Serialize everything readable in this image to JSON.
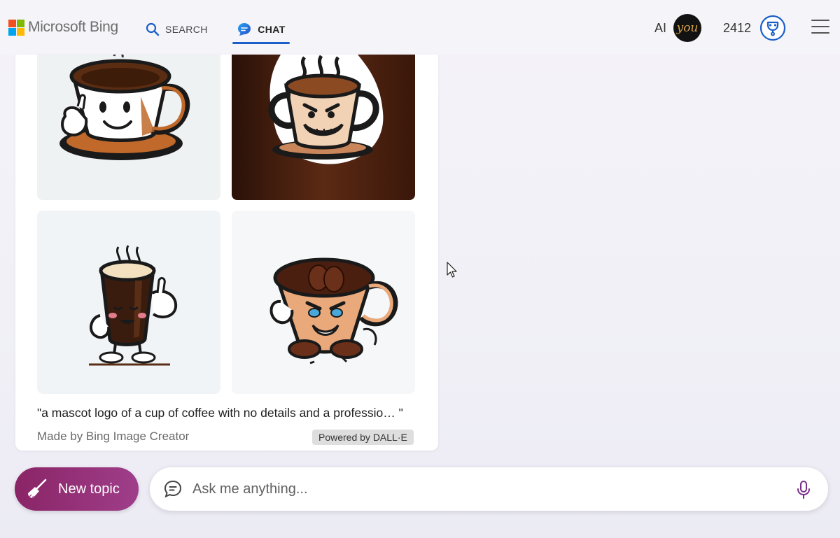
{
  "header": {
    "logo_text": "Microsoft Bing",
    "logo_colors": [
      "#f25022",
      "#7fba00",
      "#00a4ef",
      "#ffb900"
    ],
    "nav": [
      {
        "label": "SEARCH",
        "icon": "search-icon"
      },
      {
        "label": "CHAT",
        "icon": "chat-bubble-icon",
        "active": true
      }
    ],
    "ai_label": "AI",
    "avatar_text": "you",
    "points": "2412",
    "rewards_icon": "trophy-icon",
    "menu_icon": "hamburger-menu-icon"
  },
  "card": {
    "images": [
      {
        "name": "coffee-mascot-1",
        "description_icon": "coffee-cup-mascot"
      },
      {
        "name": "coffee-mascot-2",
        "description_icon": "coffee-cup-mascot"
      },
      {
        "name": "coffee-mascot-3",
        "description_icon": "coffee-cup-mascot"
      },
      {
        "name": "coffee-mascot-4",
        "description_icon": "coffee-cup-mascot"
      }
    ],
    "caption": "\"a mascot logo of a cup of coffee with no details and a professio… \"",
    "made_by": "Made by Bing Image Creator",
    "powered_by": "Powered by DALL·E"
  },
  "composer": {
    "new_topic_label": "New topic",
    "new_topic_icon": "broom-icon",
    "placeholder": "Ask me anything...",
    "mic_icon": "microphone-icon"
  },
  "colors": {
    "accent_blue": "#1a5fc7",
    "new_topic_gradient_start": "#8a2466",
    "new_topic_gradient_end": "#9f3e8a"
  }
}
